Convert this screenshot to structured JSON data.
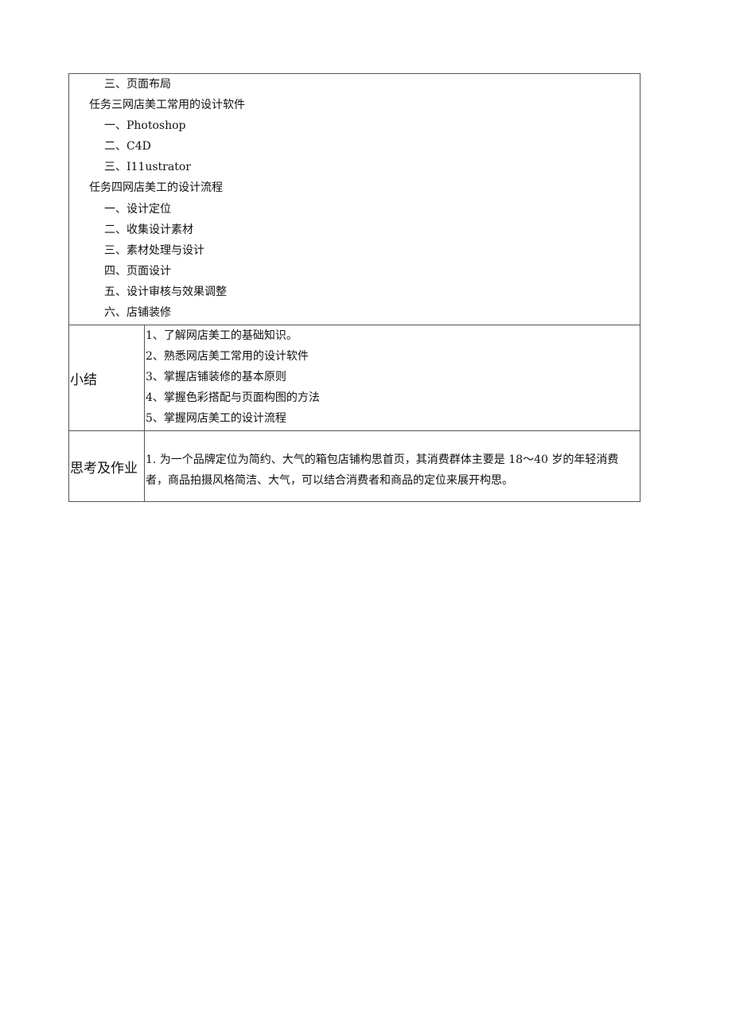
{
  "outline": {
    "items": [
      {
        "level": 2,
        "text": "三、页面布局"
      },
      {
        "level": 1,
        "text": "任务三网店美工常用的设计软件"
      },
      {
        "level": 2,
        "text": "一、Photoshop"
      },
      {
        "level": 2,
        "text": "二、C4D"
      },
      {
        "level": 2,
        "text": "三、I11ustrator"
      },
      {
        "level": 1,
        "text": "任务四网店美工的设计流程"
      },
      {
        "level": 2,
        "text": "一、设计定位"
      },
      {
        "level": 2,
        "text": "二、收集设计素材"
      },
      {
        "level": 2,
        "text": "三、素材处理与设计"
      },
      {
        "level": 2,
        "text": "四、页面设计"
      },
      {
        "level": 2,
        "text": "五、设计审核与效果调整"
      },
      {
        "level": 2,
        "text": "六、店铺装修"
      }
    ]
  },
  "summary": {
    "label": "小结",
    "items": [
      "1、了解网店美工的基础知识。",
      "2、熟悉网店美工常用的设计软件",
      "3、掌握店铺装修的基本原则",
      "4、掌握色彩搭配与页面构图的方法",
      "5、掌握网店美工的设计流程"
    ]
  },
  "homework": {
    "label": "思考及作业",
    "text": "1. 为一个品牌定位为简约、大气的箱包店铺构思首页，其消费群体主要是 18～40 岁的年轻消费者，商品拍摄风格简洁、大气，可以结合消费者和商品的定位来展开构思。"
  }
}
